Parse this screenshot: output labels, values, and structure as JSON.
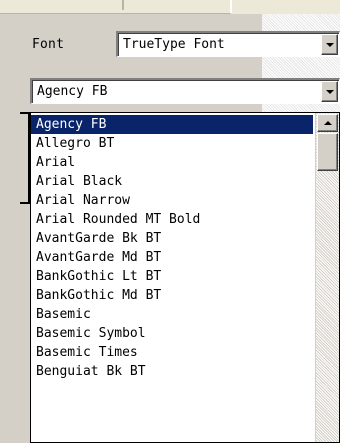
{
  "font_row": {
    "label": "Font",
    "type_value": "TrueType Font"
  },
  "font_name": {
    "value": "Agency FB"
  },
  "font_list": {
    "items": [
      "Agency FB",
      "Allegro BT",
      "Arial",
      "Arial Black",
      "Arial Narrow",
      "Arial Rounded MT Bold",
      "AvantGarde Bk BT",
      "AvantGarde Md BT",
      "BankGothic Lt BT",
      "BankGothic Md BT",
      "Basemic",
      "Basemic Symbol",
      "Basemic Times",
      "Benguiat Bk BT"
    ],
    "selected_index": 0,
    "selection_color": "#0a246a"
  },
  "icons": {
    "combo_arrow": "chevron-down-icon",
    "scroll_up": "chevron-up-icon"
  }
}
